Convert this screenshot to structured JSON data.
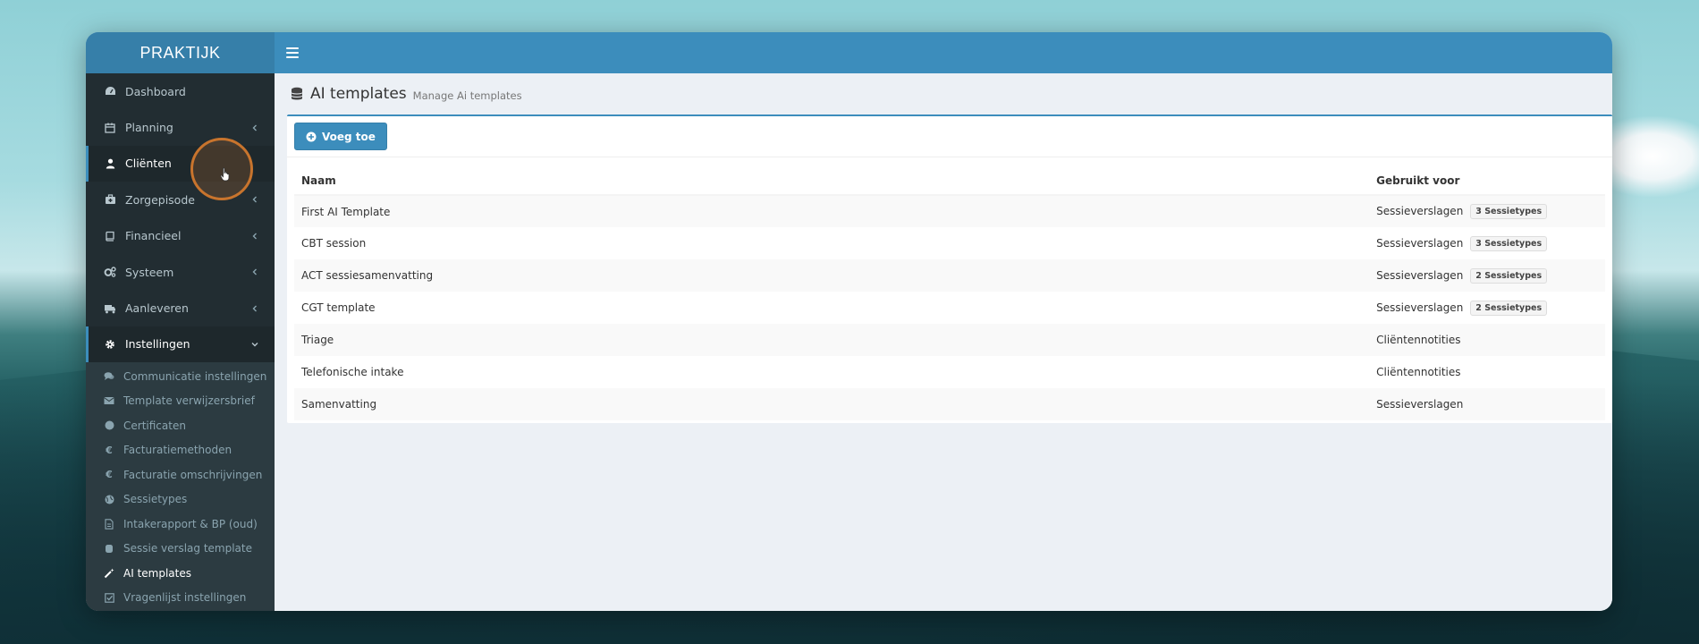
{
  "app": {
    "brand": "PRAKTIJK"
  },
  "sidebar": {
    "items": [
      {
        "label": "Dashboard",
        "icon": "dashboard-icon",
        "chevron": false
      },
      {
        "label": "Planning",
        "icon": "calendar-icon",
        "chevron": true
      },
      {
        "label": "Cliënten",
        "icon": "user-icon",
        "chevron": false,
        "active": true
      },
      {
        "label": "Zorgepisode",
        "icon": "medkit-icon",
        "chevron": true
      },
      {
        "label": "Financieel",
        "icon": "book-icon",
        "chevron": true
      },
      {
        "label": "Systeem",
        "icon": "cogs-icon",
        "chevron": true
      },
      {
        "label": "Aanleveren",
        "icon": "truck-icon",
        "chevron": true
      },
      {
        "label": "Instellingen",
        "icon": "gear-icon",
        "chevron": true,
        "expanded": true
      }
    ],
    "submenu": [
      {
        "label": "Communicatie instellingen",
        "icon": "comments-icon"
      },
      {
        "label": "Template verwijzersbrief",
        "icon": "envelope-icon"
      },
      {
        "label": "Certificaten",
        "icon": "certificate-icon"
      },
      {
        "label": "Facturatiemethoden",
        "icon": "euro-icon"
      },
      {
        "label": "Facturatie omschrijvingen",
        "icon": "euro-icon"
      },
      {
        "label": "Sessietypes",
        "icon": "globe-icon"
      },
      {
        "label": "Intakerapport & BP (oud)",
        "icon": "file-icon"
      },
      {
        "label": "Sessie verslag template",
        "icon": "database-icon"
      },
      {
        "label": "AI templates",
        "icon": "magic-wand-icon",
        "active": true
      },
      {
        "label": "Vragenlijst instellingen",
        "icon": "checkbox-icon"
      }
    ]
  },
  "header": {
    "title": "AI templates",
    "subtitle": "Manage Ai templates"
  },
  "toolbar": {
    "add_label": "Voeg toe"
  },
  "table": {
    "columns": [
      "Naam",
      "Gebruikt voor"
    ],
    "rows": [
      {
        "naam": "First AI Template",
        "gebruikt": "Sessieverslagen",
        "badge": "3 Sessietypes"
      },
      {
        "naam": "CBT session",
        "gebruikt": "Sessieverslagen",
        "badge": "3 Sessietypes"
      },
      {
        "naam": "ACT sessiesamenvatting",
        "gebruikt": "Sessieverslagen",
        "badge": "2 Sessietypes"
      },
      {
        "naam": "CGT template",
        "gebruikt": "Sessieverslagen",
        "badge": "2 Sessietypes"
      },
      {
        "naam": "Triage",
        "gebruikt": "Cliëntennotities",
        "badge": ""
      },
      {
        "naam": "Telefonische intake",
        "gebruikt": "Cliëntennotities",
        "badge": ""
      },
      {
        "naam": "Samenvatting",
        "gebruikt": "Sessieverslagen",
        "badge": ""
      }
    ]
  },
  "colors": {
    "primary": "#3c8dbc",
    "sidebar": "#222d32",
    "cursor_ring": "#c8742d"
  }
}
